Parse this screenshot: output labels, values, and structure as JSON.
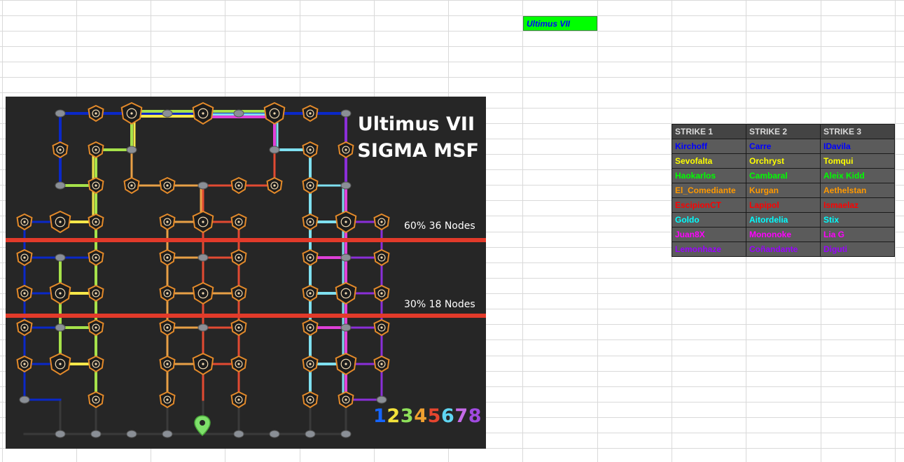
{
  "sheet": {
    "title_cell": "Ultimus VII"
  },
  "map": {
    "title_line1": "Ultimus VII",
    "title_line2": "SIGMA MSF",
    "threshold_60": "60% 36 Nodes",
    "threshold_30": "30% 18 Nodes",
    "digits": [
      "1",
      "2",
      "3",
      "4",
      "5",
      "6",
      "7",
      "8"
    ],
    "digit_colors": [
      "#1565ff",
      "#f3e23a",
      "#8ee05a",
      "#f0a030",
      "#e5452f",
      "#5fd6f2",
      "#c56ae8",
      "#a04ae0"
    ],
    "path_colors": {
      "blue": "#0a28c8",
      "yellow": "#f6e84a",
      "green": "#a6e24a",
      "orange": "#e8a046",
      "red": "#e24a32",
      "cyan": "#7fe0f0",
      "magenta": "#e040d8",
      "purple": "#8a2fd8"
    },
    "band_color": "#e23a2a"
  },
  "strike_table": {
    "headers": [
      "STRIKE 1",
      "STRIKE 2",
      "STRIKE 3"
    ],
    "rows": [
      {
        "color": "#0000ff",
        "cells": [
          "Kirchoff",
          "Carre",
          "IDavila"
        ]
      },
      {
        "color": "#ffff00",
        "cells": [
          "Sevofalta",
          "Orchryst",
          "Tomqui"
        ]
      },
      {
        "color": "#00ff00",
        "cells": [
          "Haokarlos",
          "Cambaral",
          "Aleix Kidd"
        ]
      },
      {
        "color": "#ff9900",
        "cells": [
          "El_Comediante",
          "Kurgan",
          "Aethelstan"
        ]
      },
      {
        "color": "#ff0000",
        "cells": [
          "EscipionCT",
          "Lapipol",
          "Ismaelaz"
        ]
      },
      {
        "color": "#00ffff",
        "cells": [
          "Goldo",
          "Aitordelia",
          "Stix"
        ]
      },
      {
        "color": "#ff00ff",
        "cells": [
          "Juan8X",
          "Mononoke",
          "Lia G"
        ]
      },
      {
        "color": "#9900ff",
        "cells": [
          "Lemonhaze",
          "Coñandante",
          "Diguti"
        ]
      }
    ]
  }
}
